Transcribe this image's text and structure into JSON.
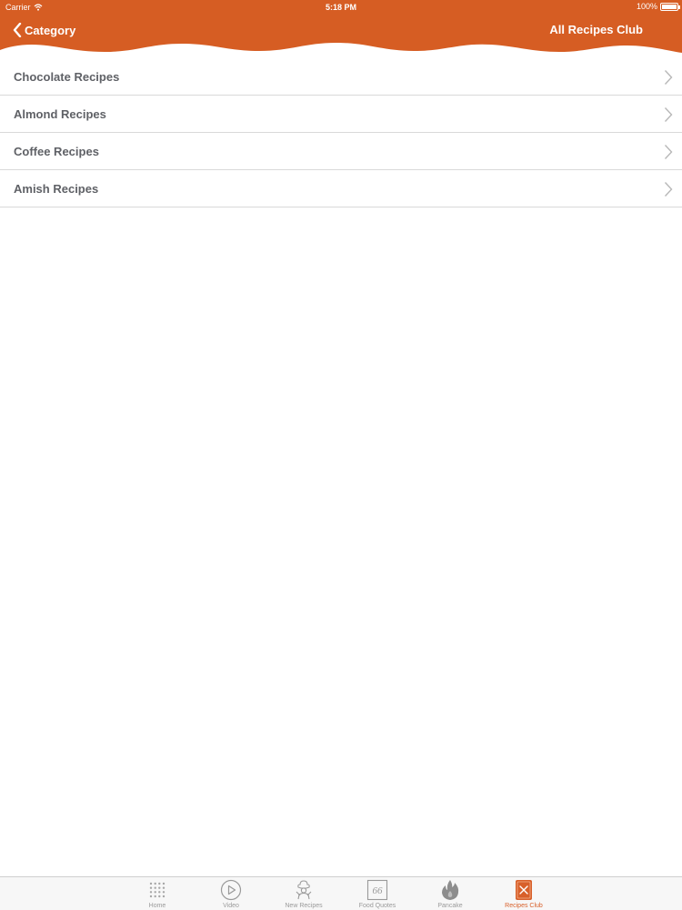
{
  "colors": {
    "accent": "#d65d23",
    "text": "#5f6166",
    "separator": "#d9d9d9",
    "tab_inactive": "#9a9a9a",
    "tab_active": "#d8602a"
  },
  "status_bar": {
    "carrier": "Carrier",
    "time": "5:18 PM",
    "battery": "100%"
  },
  "nav": {
    "back_label": "Category",
    "title": "All Recipes Club"
  },
  "list": {
    "items": [
      {
        "label": "Chocolate Recipes"
      },
      {
        "label": "Almond Recipes"
      },
      {
        "label": "Coffee Recipes"
      },
      {
        "label": "Amish Recipes"
      }
    ]
  },
  "tabbar": {
    "tabs": [
      {
        "label": "Home",
        "icon": "grid-dots-icon",
        "active": false
      },
      {
        "label": "Video",
        "icon": "play-circle-icon",
        "active": false
      },
      {
        "label": "New Recipes",
        "icon": "chef-icon",
        "active": false
      },
      {
        "label": "Food Quotes",
        "icon": "quote-icon",
        "active": false
      },
      {
        "label": "Pancake",
        "icon": "flame-icon",
        "active": false
      },
      {
        "label": "Recipes Club",
        "icon": "recipe-book-icon",
        "active": true
      }
    ]
  }
}
